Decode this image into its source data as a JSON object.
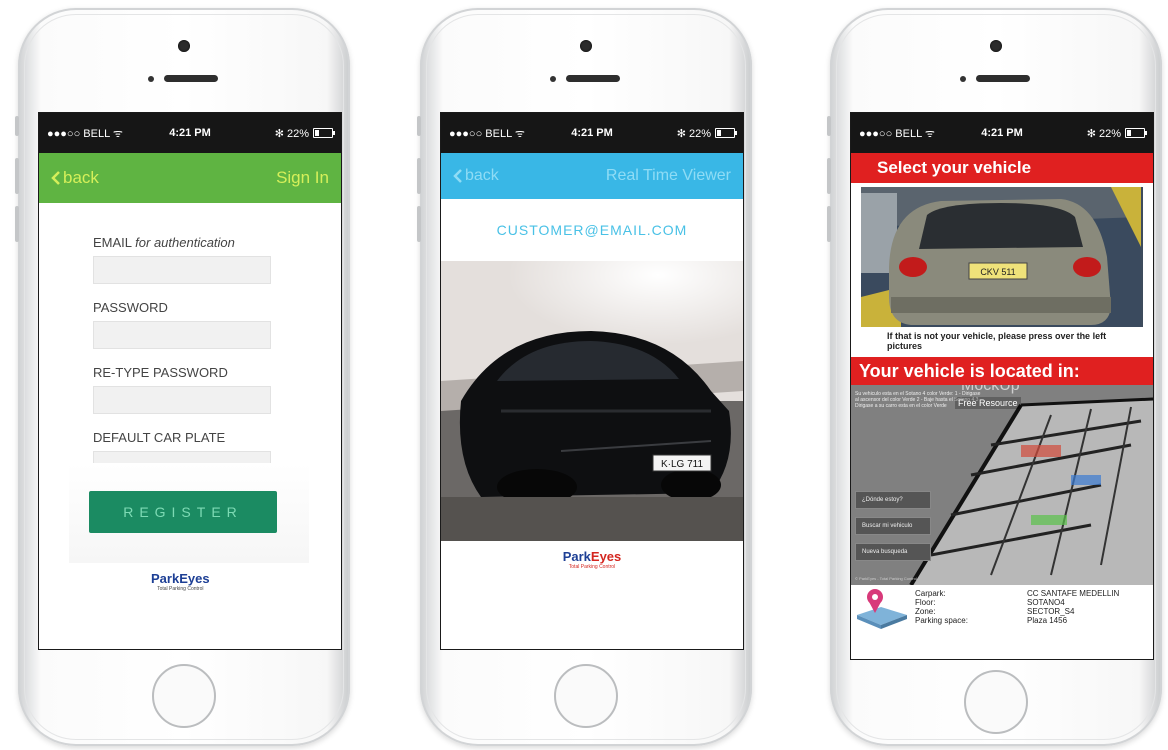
{
  "status": {
    "carrier": "●●●○○ BELL ᯤ",
    "time": "4:21 PM",
    "battery": "✻ 22%"
  },
  "phone1": {
    "back": "back",
    "title": "Sign In",
    "fields": [
      {
        "label": "EMAIL",
        "label_suffix": "for authentication"
      },
      {
        "label": "PASSWORD"
      },
      {
        "label": "RE-TYPE PASSWORD"
      },
      {
        "label": "DEFAULT CAR PLATE"
      }
    ],
    "register": "REGISTER",
    "logo": "ParkEyes",
    "logo_sub": "Total Parking Control"
  },
  "phone2": {
    "back": "back",
    "title": "Real Time Viewer",
    "email": "CUSTOMER@EMAIL.COM",
    "plate": "K·LG 711",
    "logo_park": "Park",
    "logo_eyes": "Eyes",
    "logo_sub": "Total Parking Control"
  },
  "phone3": {
    "select_title": "Select your vehicle",
    "plate": "CKV 511",
    "caption": "If that is not your vehicle, please press over the left pictures",
    "located_title": "Your vehicle is located in:",
    "map_text": "Su vehiculo esta en el Sotano 4 color Verde: 1 - Dirigase al ascensor del color Verde 2 - Baje hasta el Sotano 4 3 - Dirigase a su carro esta en el color Verde",
    "mockup": "MockUp",
    "free_resource": "Free Resource",
    "buttons": [
      "¿Dónde estoy?",
      "Buscar mi vehiculo",
      "Nueva busqueda"
    ],
    "map_footer": "© ParkEyes - Total Parking Control",
    "info": [
      {
        "key": "Carpark:",
        "value": "CC SANTAFE MEDELLIN"
      },
      {
        "key": "Floor:",
        "value": "SOTANO4"
      },
      {
        "key": "Zone:",
        "value": "SECTOR_S4"
      },
      {
        "key": "Parking space:",
        "value": "Plaza 1456"
      }
    ]
  }
}
